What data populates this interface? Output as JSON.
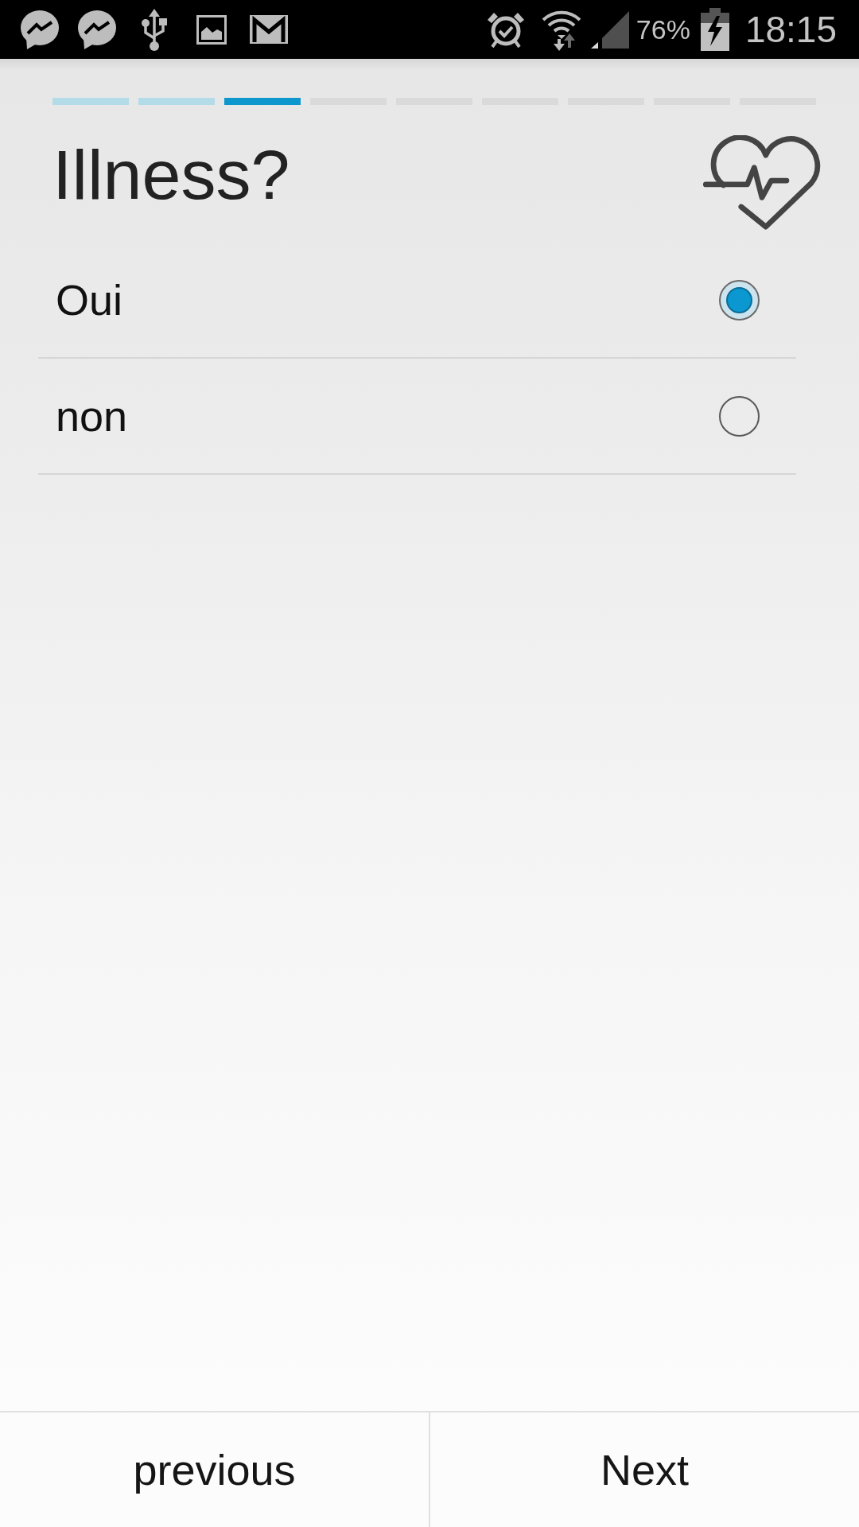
{
  "status_bar": {
    "battery": "76%",
    "time": "18:15"
  },
  "progress": {
    "steps": [
      {
        "kind": "done"
      },
      {
        "kind": "done"
      },
      {
        "kind": "current"
      },
      {
        "kind": "pending"
      },
      {
        "kind": "pending"
      },
      {
        "kind": "pending"
      },
      {
        "kind": "pending"
      },
      {
        "kind": "pending"
      },
      {
        "kind": "pending"
      }
    ]
  },
  "question": {
    "title": "Illness?"
  },
  "options": [
    {
      "label": "Oui",
      "selected": true
    },
    {
      "label": "non",
      "selected": false
    }
  ],
  "buttons": [
    {
      "label": "previous"
    },
    {
      "label": "Next"
    }
  ]
}
